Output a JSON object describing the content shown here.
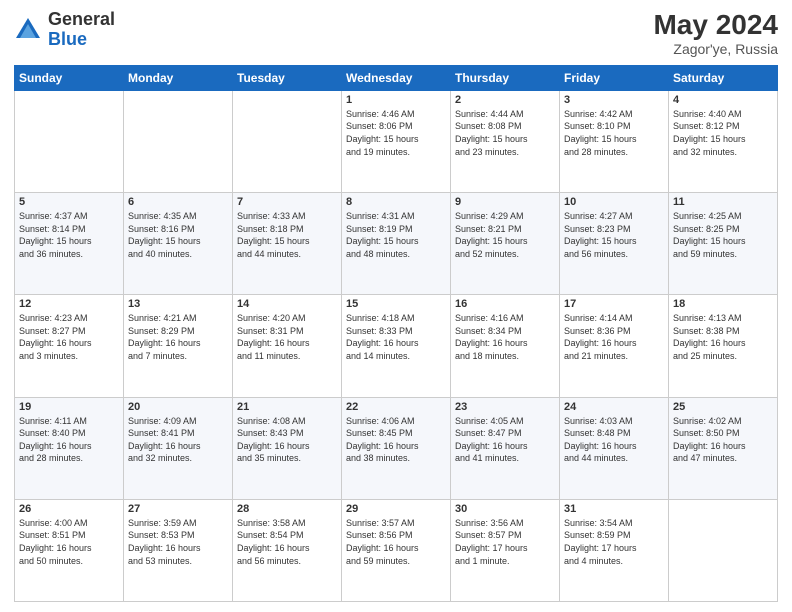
{
  "logo": {
    "general": "General",
    "blue": "Blue"
  },
  "header": {
    "month_year": "May 2024",
    "location": "Zagor'ye, Russia"
  },
  "weekdays": [
    "Sunday",
    "Monday",
    "Tuesday",
    "Wednesday",
    "Thursday",
    "Friday",
    "Saturday"
  ],
  "weeks": [
    [
      {
        "day": "",
        "info": ""
      },
      {
        "day": "",
        "info": ""
      },
      {
        "day": "",
        "info": ""
      },
      {
        "day": "1",
        "info": "Sunrise: 4:46 AM\nSunset: 8:06 PM\nDaylight: 15 hours\nand 19 minutes."
      },
      {
        "day": "2",
        "info": "Sunrise: 4:44 AM\nSunset: 8:08 PM\nDaylight: 15 hours\nand 23 minutes."
      },
      {
        "day": "3",
        "info": "Sunrise: 4:42 AM\nSunset: 8:10 PM\nDaylight: 15 hours\nand 28 minutes."
      },
      {
        "day": "4",
        "info": "Sunrise: 4:40 AM\nSunset: 8:12 PM\nDaylight: 15 hours\nand 32 minutes."
      }
    ],
    [
      {
        "day": "5",
        "info": "Sunrise: 4:37 AM\nSunset: 8:14 PM\nDaylight: 15 hours\nand 36 minutes."
      },
      {
        "day": "6",
        "info": "Sunrise: 4:35 AM\nSunset: 8:16 PM\nDaylight: 15 hours\nand 40 minutes."
      },
      {
        "day": "7",
        "info": "Sunrise: 4:33 AM\nSunset: 8:18 PM\nDaylight: 15 hours\nand 44 minutes."
      },
      {
        "day": "8",
        "info": "Sunrise: 4:31 AM\nSunset: 8:19 PM\nDaylight: 15 hours\nand 48 minutes."
      },
      {
        "day": "9",
        "info": "Sunrise: 4:29 AM\nSunset: 8:21 PM\nDaylight: 15 hours\nand 52 minutes."
      },
      {
        "day": "10",
        "info": "Sunrise: 4:27 AM\nSunset: 8:23 PM\nDaylight: 15 hours\nand 56 minutes."
      },
      {
        "day": "11",
        "info": "Sunrise: 4:25 AM\nSunset: 8:25 PM\nDaylight: 15 hours\nand 59 minutes."
      }
    ],
    [
      {
        "day": "12",
        "info": "Sunrise: 4:23 AM\nSunset: 8:27 PM\nDaylight: 16 hours\nand 3 minutes."
      },
      {
        "day": "13",
        "info": "Sunrise: 4:21 AM\nSunset: 8:29 PM\nDaylight: 16 hours\nand 7 minutes."
      },
      {
        "day": "14",
        "info": "Sunrise: 4:20 AM\nSunset: 8:31 PM\nDaylight: 16 hours\nand 11 minutes."
      },
      {
        "day": "15",
        "info": "Sunrise: 4:18 AM\nSunset: 8:33 PM\nDaylight: 16 hours\nand 14 minutes."
      },
      {
        "day": "16",
        "info": "Sunrise: 4:16 AM\nSunset: 8:34 PM\nDaylight: 16 hours\nand 18 minutes."
      },
      {
        "day": "17",
        "info": "Sunrise: 4:14 AM\nSunset: 8:36 PM\nDaylight: 16 hours\nand 21 minutes."
      },
      {
        "day": "18",
        "info": "Sunrise: 4:13 AM\nSunset: 8:38 PM\nDaylight: 16 hours\nand 25 minutes."
      }
    ],
    [
      {
        "day": "19",
        "info": "Sunrise: 4:11 AM\nSunset: 8:40 PM\nDaylight: 16 hours\nand 28 minutes."
      },
      {
        "day": "20",
        "info": "Sunrise: 4:09 AM\nSunset: 8:41 PM\nDaylight: 16 hours\nand 32 minutes."
      },
      {
        "day": "21",
        "info": "Sunrise: 4:08 AM\nSunset: 8:43 PM\nDaylight: 16 hours\nand 35 minutes."
      },
      {
        "day": "22",
        "info": "Sunrise: 4:06 AM\nSunset: 8:45 PM\nDaylight: 16 hours\nand 38 minutes."
      },
      {
        "day": "23",
        "info": "Sunrise: 4:05 AM\nSunset: 8:47 PM\nDaylight: 16 hours\nand 41 minutes."
      },
      {
        "day": "24",
        "info": "Sunrise: 4:03 AM\nSunset: 8:48 PM\nDaylight: 16 hours\nand 44 minutes."
      },
      {
        "day": "25",
        "info": "Sunrise: 4:02 AM\nSunset: 8:50 PM\nDaylight: 16 hours\nand 47 minutes."
      }
    ],
    [
      {
        "day": "26",
        "info": "Sunrise: 4:00 AM\nSunset: 8:51 PM\nDaylight: 16 hours\nand 50 minutes."
      },
      {
        "day": "27",
        "info": "Sunrise: 3:59 AM\nSunset: 8:53 PM\nDaylight: 16 hours\nand 53 minutes."
      },
      {
        "day": "28",
        "info": "Sunrise: 3:58 AM\nSunset: 8:54 PM\nDaylight: 16 hours\nand 56 minutes."
      },
      {
        "day": "29",
        "info": "Sunrise: 3:57 AM\nSunset: 8:56 PM\nDaylight: 16 hours\nand 59 minutes."
      },
      {
        "day": "30",
        "info": "Sunrise: 3:56 AM\nSunset: 8:57 PM\nDaylight: 17 hours\nand 1 minute."
      },
      {
        "day": "31",
        "info": "Sunrise: 3:54 AM\nSunset: 8:59 PM\nDaylight: 17 hours\nand 4 minutes."
      },
      {
        "day": "",
        "info": ""
      }
    ]
  ]
}
